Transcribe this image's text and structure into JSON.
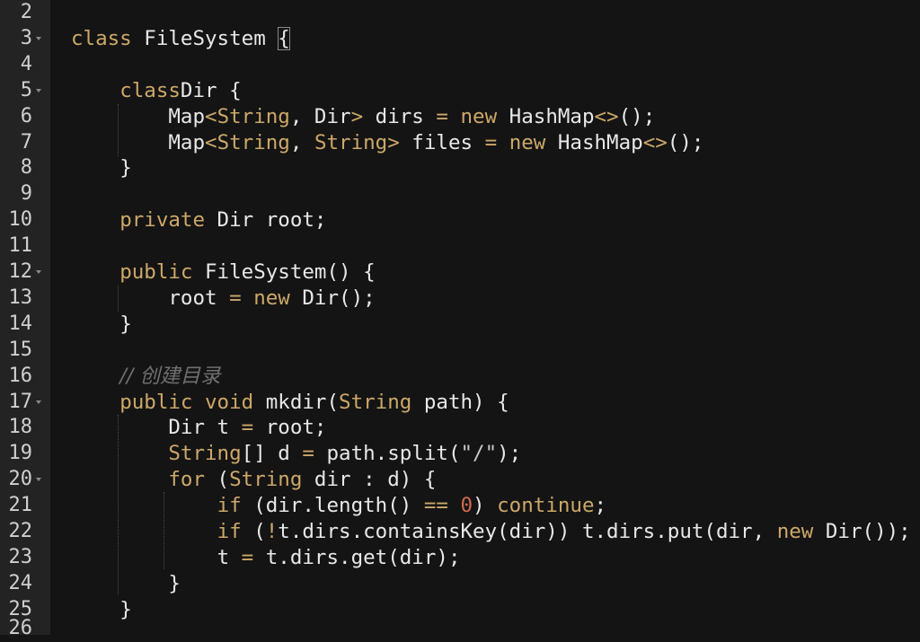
{
  "gutter": {
    "line_numbers": [
      "2",
      "3",
      "4",
      "5",
      "6",
      "7",
      "8",
      "9",
      "10",
      "11",
      "12",
      "13",
      "14",
      "15",
      "16",
      "17",
      "18",
      "19",
      "20",
      "21",
      "22",
      "23",
      "24",
      "25",
      "26"
    ],
    "fold_markers_on": [
      "3",
      "5",
      "12",
      "17",
      "20"
    ]
  },
  "code": {
    "l3": {
      "kw": "class",
      "name": "FileSystem",
      "brace": "{"
    },
    "l5": {
      "kw": "class",
      "rest": "Dir {"
    },
    "l6": {
      "a": "Map",
      "b": "<",
      "c": "String",
      "d": ", Dir",
      "e": ">",
      "f": " dirs ",
      "g": "=",
      "h": " ",
      "i": "new",
      "j": " HashMap",
      "k": "<>",
      "l": "();"
    },
    "l7": {
      "a": "Map",
      "b": "<",
      "c": "String",
      "d": ", ",
      "e": "String",
      "f": ">",
      "g": " files ",
      "h": "=",
      "i": " ",
      "j": "new",
      "k": " HashMap",
      "l": "<>",
      "m": "();"
    },
    "l8": {
      "text": "}"
    },
    "l10": {
      "kw": "private",
      "rest": " Dir root;"
    },
    "l12": {
      "kw": "public",
      "rest": " FileSystem() {"
    },
    "l13": {
      "a": "root ",
      "b": "=",
      "c": " ",
      "d": "new",
      "e": " Dir();"
    },
    "l14": {
      "text": "}"
    },
    "l16": {
      "comment": "// 创建目录"
    },
    "l17": {
      "kw": "public",
      "sp": " ",
      "kw2": "void",
      "a": " mkdir(",
      "ty": "String",
      "b": " path) {"
    },
    "l18": {
      "a": "Dir t ",
      "b": "=",
      "c": " root;"
    },
    "l19": {
      "ty": "String",
      "a": "[] d ",
      "b": "=",
      "c": " path.split(",
      "str": "\"/\"",
      "d": ");"
    },
    "l20": {
      "kw": "for",
      "a": " (",
      "ty": "String",
      "b": " dir : d) {"
    },
    "l21": {
      "kw": "if",
      "a": " (dir.length() ",
      "op": "==",
      "sp": " ",
      "num": "0",
      "b": ") ",
      "kw2": "continue",
      "c": ";"
    },
    "l22": {
      "kw": "if",
      "a": " (",
      "op": "!",
      "b": "t.dirs.containsKey(dir)) t.dirs.put(dir, ",
      "kw2": "new",
      "c": " Dir());"
    },
    "l23": {
      "a": "t ",
      "b": "=",
      "c": " t.dirs.get(dir);"
    },
    "l24": {
      "text": "}"
    },
    "l25": {
      "text": "}"
    }
  },
  "colors": {
    "background": "#141414",
    "gutter": "#232323",
    "keyword": "#cda869",
    "number": "#cf6a4c",
    "comment": "#6f6f6f",
    "text": "#e8e8e8"
  }
}
